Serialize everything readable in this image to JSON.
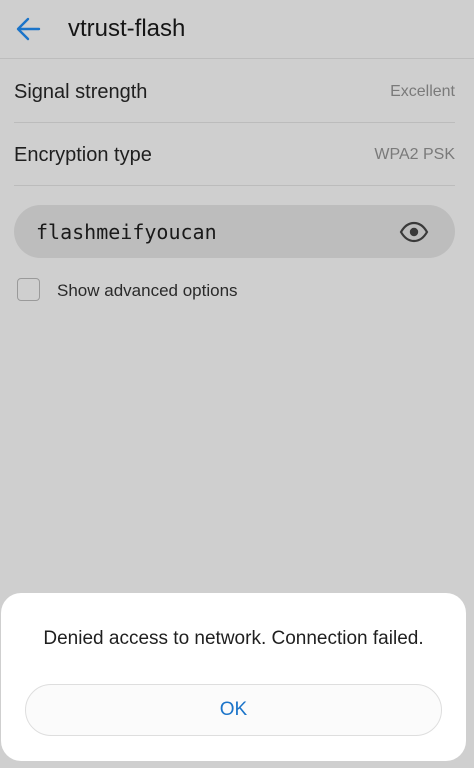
{
  "header": {
    "title": "vtrust-flash",
    "back_icon": "arrow-left-icon",
    "accent_color": "#1b74c9"
  },
  "details": [
    {
      "label": "Signal strength",
      "value": "Excellent"
    },
    {
      "label": "Encryption type",
      "value": "WPA2 PSK"
    }
  ],
  "password": {
    "value": "flashmeifyoucan",
    "visibility_icon": "eye-icon"
  },
  "advanced_options": {
    "label": "Show advanced options",
    "checked": false
  },
  "dialog": {
    "message": "Denied access to network. Connection failed.",
    "ok_label": "OK"
  }
}
